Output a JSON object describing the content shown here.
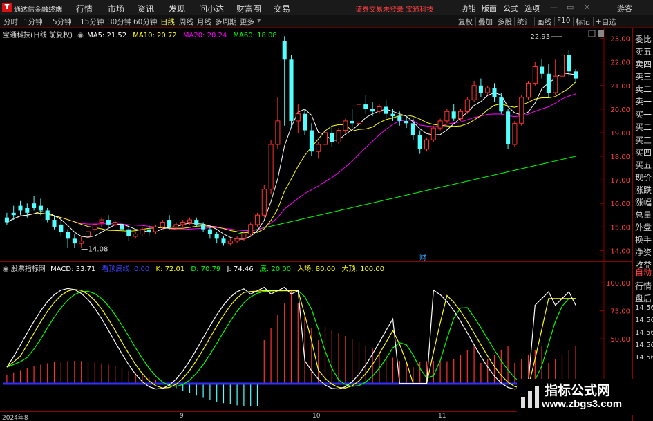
{
  "titlebar": {
    "app_name": "通达信金融终端",
    "menus": [
      "行情",
      "市场",
      "资讯",
      "发现",
      "问小达",
      "财富圈",
      "交易"
    ],
    "warning": "证券交易未登录  宝通科技",
    "right_menus": [
      "功能",
      "版面",
      "公式",
      "选项"
    ],
    "guest": "游客"
  },
  "toolbar": {
    "tabs": [
      "分时",
      "1分钟",
      "5分钟",
      "15分钟",
      "30分钟",
      "60分钟",
      "日线",
      "周线",
      "月线",
      "多周期",
      "更多"
    ],
    "active_tab": "日线",
    "right": [
      "复权",
      "叠加",
      "多股",
      "统计",
      "画线",
      "F10",
      "标记",
      "+自选"
    ]
  },
  "main_chart": {
    "title": "宝通科技(日线 前复权)",
    "ma5": "MA5: 21.52",
    "ma10": "MA10: 20.72",
    "ma20": "MA20: 20.24",
    "ma60": "MA60: 18.08",
    "high_label": "22.93",
    "low_label": "14.08",
    "event_mark": "财",
    "colors": {
      "up": "#ff3232",
      "down": "#54ffff",
      "ma5": "#ffffff",
      "ma10": "#ffff00",
      "ma20": "#ff00ff",
      "ma60": "#00ff00"
    }
  },
  "indicator": {
    "name": "股票指标网",
    "macd": "MACD: 33.71",
    "kd_label": "看顶底线: 0.00",
    "k": "K: 72.01",
    "d": "D: 70.79",
    "j": "J: 74.46",
    "di": "底: 20.00",
    "ru": "入场: 80.00",
    "ding": "大顶: 100.00"
  },
  "date_axis": [
    "2024年8",
    "9",
    "10",
    "11"
  ],
  "right_panel": [
    "委比",
    "卖五",
    "卖四",
    "卖三",
    "卖二",
    "卖一",
    "买一",
    "买二",
    "买三",
    "买四",
    "买五",
    "现价",
    "涨跌",
    "涨幅",
    "总量",
    "外盘",
    "换手",
    "净资",
    "收益",
    "自动",
    "行情",
    "盘后",
    "14:56",
    "14:56",
    "14:56",
    "14:56",
    "14:56"
  ],
  "watermark": {
    "cn": "指标公式网",
    "url": "www.zbgs3.com"
  },
  "chart_data": [
    {
      "type": "candlestick",
      "title": "宝通科技(日线 前复权)",
      "y_ticks": [
        14.0,
        15.0,
        16.0,
        17.0,
        18.0,
        19.0,
        20.0,
        21.0,
        22.0,
        23.0
      ],
      "ylim": [
        13.6,
        23.4
      ],
      "candles": [
        [
          15.4,
          15.6,
          15.2,
          15.1
        ],
        [
          15.6,
          15.9,
          15.5,
          15.3
        ],
        [
          15.9,
          16.1,
          15.7,
          15.5
        ],
        [
          15.8,
          16.0,
          15.6,
          15.4
        ],
        [
          16.0,
          16.3,
          15.8,
          15.7
        ],
        [
          15.9,
          16.2,
          15.7,
          15.5
        ],
        [
          15.7,
          15.8,
          15.3,
          15.2
        ],
        [
          15.3,
          15.5,
          15.0,
          14.9
        ],
        [
          15.1,
          15.3,
          14.8,
          14.6
        ],
        [
          14.8,
          14.9,
          14.5,
          14.1
        ],
        [
          14.5,
          14.7,
          14.3,
          14.1
        ],
        [
          14.3,
          14.6,
          14.4,
          14.1
        ],
        [
          14.6,
          14.9,
          14.8,
          14.4
        ],
        [
          14.9,
          15.2,
          15.1,
          14.8
        ],
        [
          15.2,
          15.4,
          15.3,
          15.0
        ],
        [
          15.3,
          15.5,
          15.1,
          15.0
        ],
        [
          15.1,
          15.3,
          15.2,
          15.0
        ],
        [
          15.1,
          15.2,
          14.9,
          14.8
        ],
        [
          14.9,
          15.0,
          14.6,
          14.4
        ],
        [
          14.6,
          14.8,
          14.7,
          14.5
        ],
        [
          14.7,
          15.0,
          14.9,
          14.6
        ],
        [
          14.9,
          15.1,
          14.8,
          14.6
        ],
        [
          14.8,
          15.1,
          15.0,
          14.7
        ],
        [
          15.0,
          15.3,
          15.2,
          14.9
        ],
        [
          15.3,
          15.5,
          15.0,
          14.9
        ],
        [
          15.0,
          15.2,
          15.1,
          14.9
        ],
        [
          15.1,
          15.3,
          15.2,
          15.0
        ],
        [
          15.2,
          15.4,
          15.3,
          15.1
        ],
        [
          15.3,
          15.4,
          15.1,
          15.0
        ],
        [
          15.1,
          15.2,
          14.9,
          14.8
        ],
        [
          14.9,
          15.0,
          14.7,
          14.5
        ],
        [
          14.7,
          14.8,
          14.5,
          14.3
        ],
        [
          14.5,
          14.6,
          14.3,
          14.2
        ],
        [
          14.3,
          14.5,
          14.4,
          14.2
        ],
        [
          14.4,
          14.6,
          14.5,
          14.3
        ],
        [
          14.5,
          14.8,
          14.7,
          14.4
        ],
        [
          14.7,
          15.2,
          15.1,
          14.6
        ],
        [
          15.1,
          15.6,
          15.5,
          15.0
        ],
        [
          15.5,
          16.8,
          16.6,
          15.4
        ],
        [
          16.6,
          18.7,
          18.5,
          16.4
        ],
        [
          18.5,
          20.5,
          19.5,
          18.3
        ],
        [
          22.9,
          23.1,
          22.1,
          19.3
        ],
        [
          22.1,
          22.3,
          19.5,
          19.2
        ],
        [
          19.5,
          20.2,
          19.8,
          19.0
        ],
        [
          19.8,
          20.0,
          19.1,
          18.9
        ],
        [
          19.1,
          19.4,
          18.2,
          18.0
        ],
        [
          18.2,
          18.6,
          18.5,
          17.9
        ],
        [
          18.5,
          19.1,
          19.0,
          18.3
        ],
        [
          19.0,
          19.3,
          18.6,
          18.4
        ],
        [
          18.6,
          19.2,
          19.1,
          18.5
        ],
        [
          19.1,
          19.6,
          19.5,
          19.0
        ],
        [
          19.5,
          20.0,
          19.4,
          19.2
        ],
        [
          19.4,
          20.3,
          20.2,
          19.3
        ],
        [
          20.2,
          20.6,
          20.0,
          19.8
        ],
        [
          20.0,
          20.3,
          19.9,
          19.7
        ],
        [
          19.9,
          20.2,
          20.1,
          19.8
        ],
        [
          20.1,
          20.4,
          19.8,
          19.6
        ],
        [
          19.8,
          20.0,
          19.7,
          19.5
        ],
        [
          19.7,
          19.9,
          19.5,
          19.3
        ],
        [
          19.5,
          19.7,
          19.4,
          19.2
        ],
        [
          19.4,
          19.6,
          18.9,
          18.7
        ],
        [
          18.9,
          19.1,
          18.3,
          18.1
        ],
        [
          18.3,
          18.8,
          18.7,
          18.2
        ],
        [
          18.7,
          19.3,
          19.2,
          18.6
        ],
        [
          19.2,
          19.6,
          19.5,
          19.1
        ],
        [
          19.5,
          20.0,
          19.9,
          19.4
        ],
        [
          19.9,
          20.2,
          19.6,
          19.5
        ],
        [
          19.6,
          20.0,
          19.9,
          19.5
        ],
        [
          19.9,
          20.5,
          20.4,
          19.8
        ],
        [
          20.4,
          21.2,
          21.0,
          20.3
        ],
        [
          21.0,
          21.3,
          20.7,
          20.5
        ],
        [
          20.7,
          21.0,
          20.9,
          20.6
        ],
        [
          20.9,
          21.1,
          20.5,
          20.3
        ],
        [
          20.5,
          20.7,
          19.9,
          19.8
        ],
        [
          19.9,
          20.0,
          18.5,
          18.3
        ],
        [
          18.5,
          19.5,
          19.4,
          18.4
        ],
        [
          19.4,
          20.6,
          20.5,
          19.3
        ],
        [
          20.5,
          21.2,
          21.1,
          20.4
        ],
        [
          21.1,
          22.0,
          21.8,
          21.0
        ],
        [
          21.8,
          22.1,
          21.5,
          21.3
        ],
        [
          21.5,
          21.9,
          20.7,
          20.5
        ],
        [
          20.7,
          22.1,
          21.4,
          20.6
        ],
        [
          21.4,
          22.9,
          22.3,
          21.3
        ],
        [
          22.3,
          22.5,
          21.6,
          21.4
        ],
        [
          21.6,
          21.7,
          21.3,
          21.1
        ]
      ],
      "series": [
        {
          "name": "MA5",
          "color": "#ffffff"
        },
        {
          "name": "MA10",
          "color": "#ffff00"
        },
        {
          "name": "MA20",
          "color": "#ff00ff"
        },
        {
          "name": "MA60",
          "color": "#00ff00"
        }
      ]
    },
    {
      "type": "line",
      "title": "股票指标网",
      "y_ticks": [
        50.0,
        75.0,
        100.0
      ],
      "series": [
        {
          "name": "K",
          "color": "#ffff00"
        },
        {
          "name": "D",
          "color": "#00ff00"
        },
        {
          "name": "J",
          "color": "#ffffff"
        }
      ]
    }
  ]
}
